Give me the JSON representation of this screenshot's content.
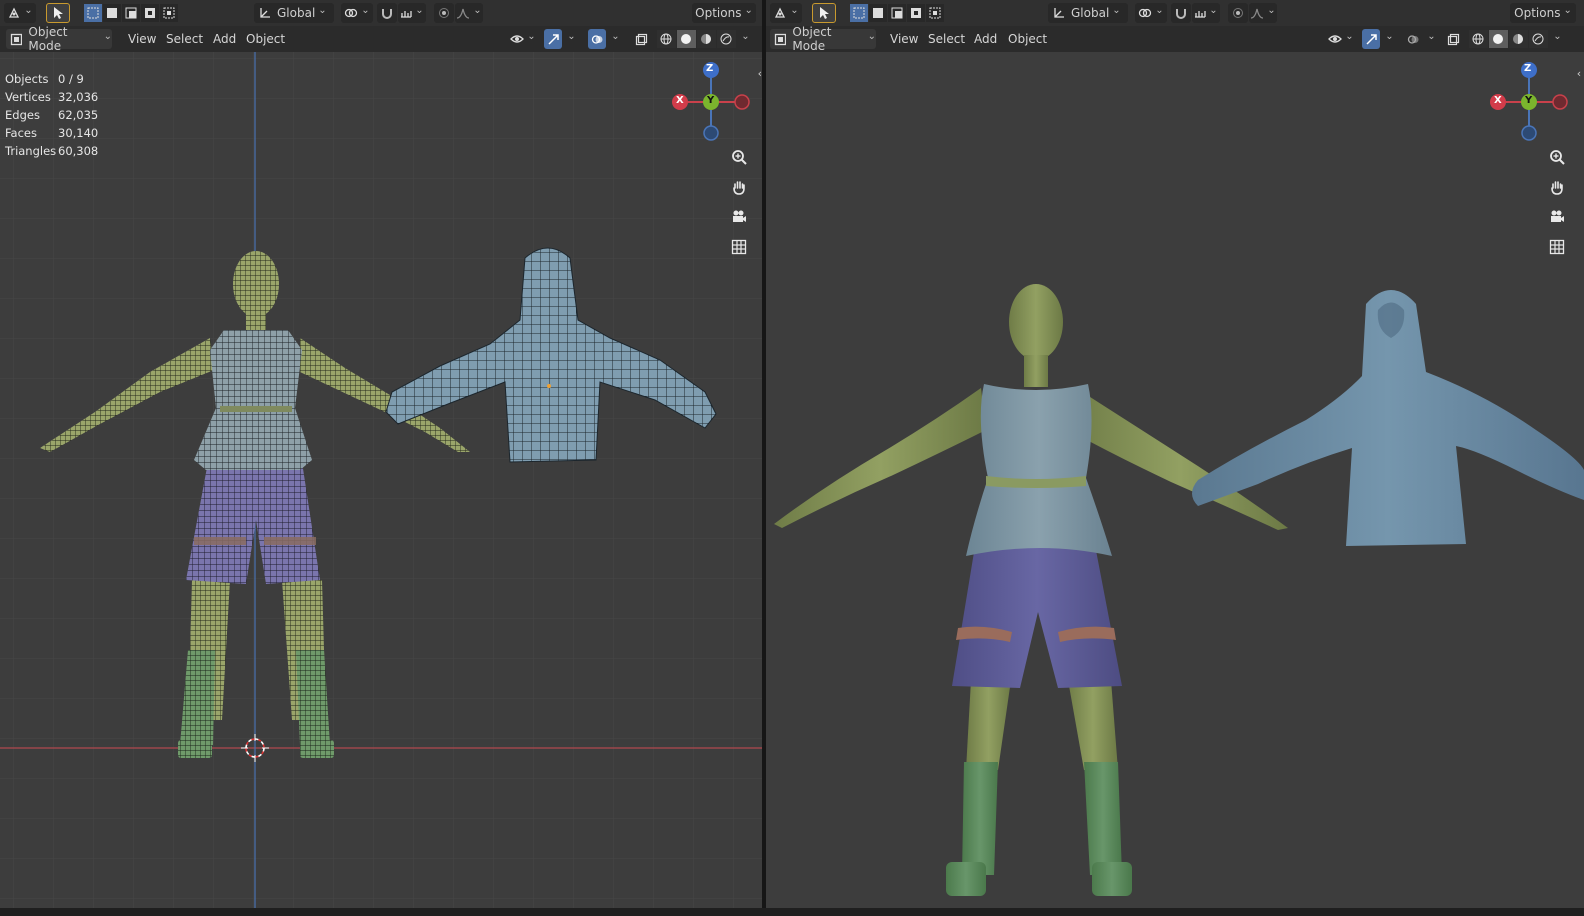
{
  "left_viewport": {
    "toolbar": {
      "orientation": "Global",
      "options_label": "Options"
    },
    "header": {
      "mode": "Object Mode",
      "menus": [
        "View",
        "Select",
        "Add",
        "Object"
      ]
    },
    "stats": [
      {
        "label": "Objects",
        "value": "0 / 9"
      },
      {
        "label": "Vertices",
        "value": "32,036"
      },
      {
        "label": "Edges",
        "value": "62,035"
      },
      {
        "label": "Faces",
        "value": "30,140"
      },
      {
        "label": "Triangles",
        "value": "60,308"
      }
    ],
    "gizmo": {
      "z": "Z",
      "y": "Y",
      "x": "X"
    },
    "shading": "wireframe-overlay"
  },
  "right_viewport": {
    "toolbar": {
      "orientation": "Global",
      "options_label": "Options"
    },
    "header": {
      "mode": "Object Mode",
      "menus": [
        "View",
        "Select",
        "Add",
        "Object"
      ]
    },
    "gizmo": {
      "z": "Z",
      "y": "Y",
      "x": "X"
    },
    "shading": "solid"
  },
  "colors": {
    "viewport_bg": "#3d3d3d",
    "grid_line": "#484848",
    "axis_x": "#b9474f",
    "axis_z": "#4a75b8",
    "skin": "#8c9a5c",
    "shirt": "#7f97a6",
    "shorts": "#5f5f99",
    "boots": "#5d8a5c",
    "belt": "#9b6f5c",
    "hoodie": "#6f8ca6",
    "select_active": "#c99a2e"
  }
}
